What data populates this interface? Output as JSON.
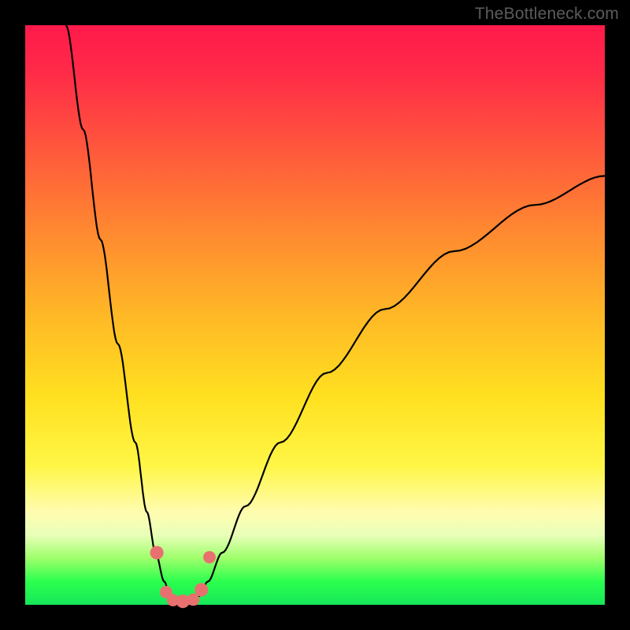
{
  "watermark": "TheBottleneck.com",
  "colors": {
    "frame": "#000000",
    "curve_stroke": "#000000",
    "marker_fill": "#e8716f",
    "marker_stroke": "#d65a58"
  },
  "chart_data": {
    "type": "line",
    "title": "",
    "xlabel": "",
    "ylabel": "",
    "xlim": [
      0,
      100
    ],
    "ylim": [
      0,
      100
    ],
    "series": [
      {
        "name": "left-branch",
        "x": [
          7,
          10,
          13,
          16,
          19,
          21,
          22.5,
          24,
          25,
          25.8
        ],
        "y": [
          100,
          82,
          63,
          45,
          28,
          16,
          9,
          4,
          1.5,
          0.5
        ]
      },
      {
        "name": "right-branch",
        "x": [
          29,
          30,
          31.5,
          34,
          38,
          44,
          52,
          62,
          74,
          88,
          100
        ],
        "y": [
          0.5,
          1.5,
          4,
          9,
          17,
          28,
          40,
          51,
          61,
          69,
          74
        ]
      }
    ],
    "markers": [
      {
        "x": 22.7,
        "y": 9.0,
        "r": 1.3
      },
      {
        "x": 24.3,
        "y": 2.2,
        "r": 1.2
      },
      {
        "x": 25.5,
        "y": 0.8,
        "r": 1.2
      },
      {
        "x": 27.2,
        "y": 0.6,
        "r": 1.3
      },
      {
        "x": 29.0,
        "y": 0.9,
        "r": 1.2
      },
      {
        "x": 30.4,
        "y": 2.6,
        "r": 1.3
      },
      {
        "x": 31.8,
        "y": 8.2,
        "r": 1.2
      }
    ]
  }
}
